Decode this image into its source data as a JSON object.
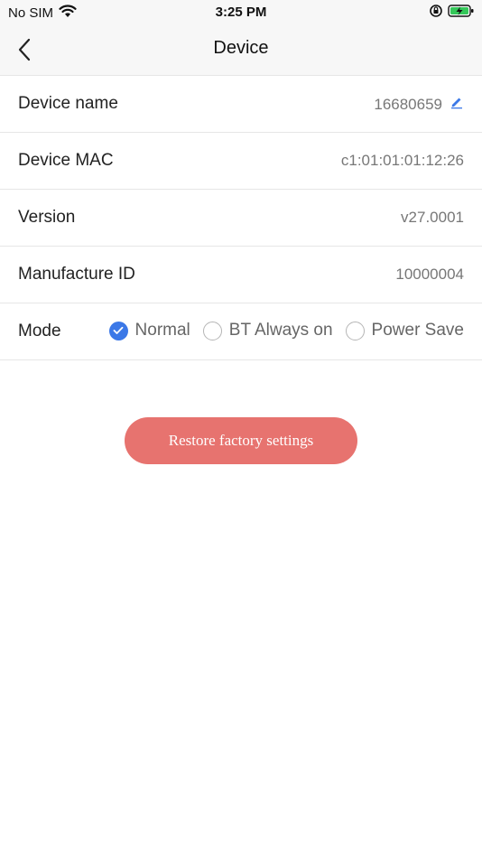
{
  "status_bar": {
    "carrier": "No SIM",
    "time": "3:25 PM",
    "icons": [
      "wifi-icon",
      "orientation-lock-icon",
      "battery-charging-icon"
    ]
  },
  "nav": {
    "title": "Device",
    "back_icon": "chevron-left-icon"
  },
  "device_info": {
    "name_label": "Device name",
    "name_value": "16680659",
    "mac_label": "Device MAC",
    "mac_value": "c1:01:01:01:12:26",
    "version_label": "Version",
    "version_value": "v27.0001",
    "manufacture_label": "Manufacture ID",
    "manufacture_value": "10000004"
  },
  "mode": {
    "label": "Mode",
    "options": [
      {
        "label": "Normal",
        "selected": true
      },
      {
        "label": "BT Always on",
        "selected": false
      },
      {
        "label": "Power Save",
        "selected": false
      }
    ]
  },
  "restore_button": {
    "label": "Restore factory settings"
  },
  "colors": {
    "accent": "#3b78e7",
    "restore": "#e7736f",
    "edit_icon": "#3b78e7"
  }
}
